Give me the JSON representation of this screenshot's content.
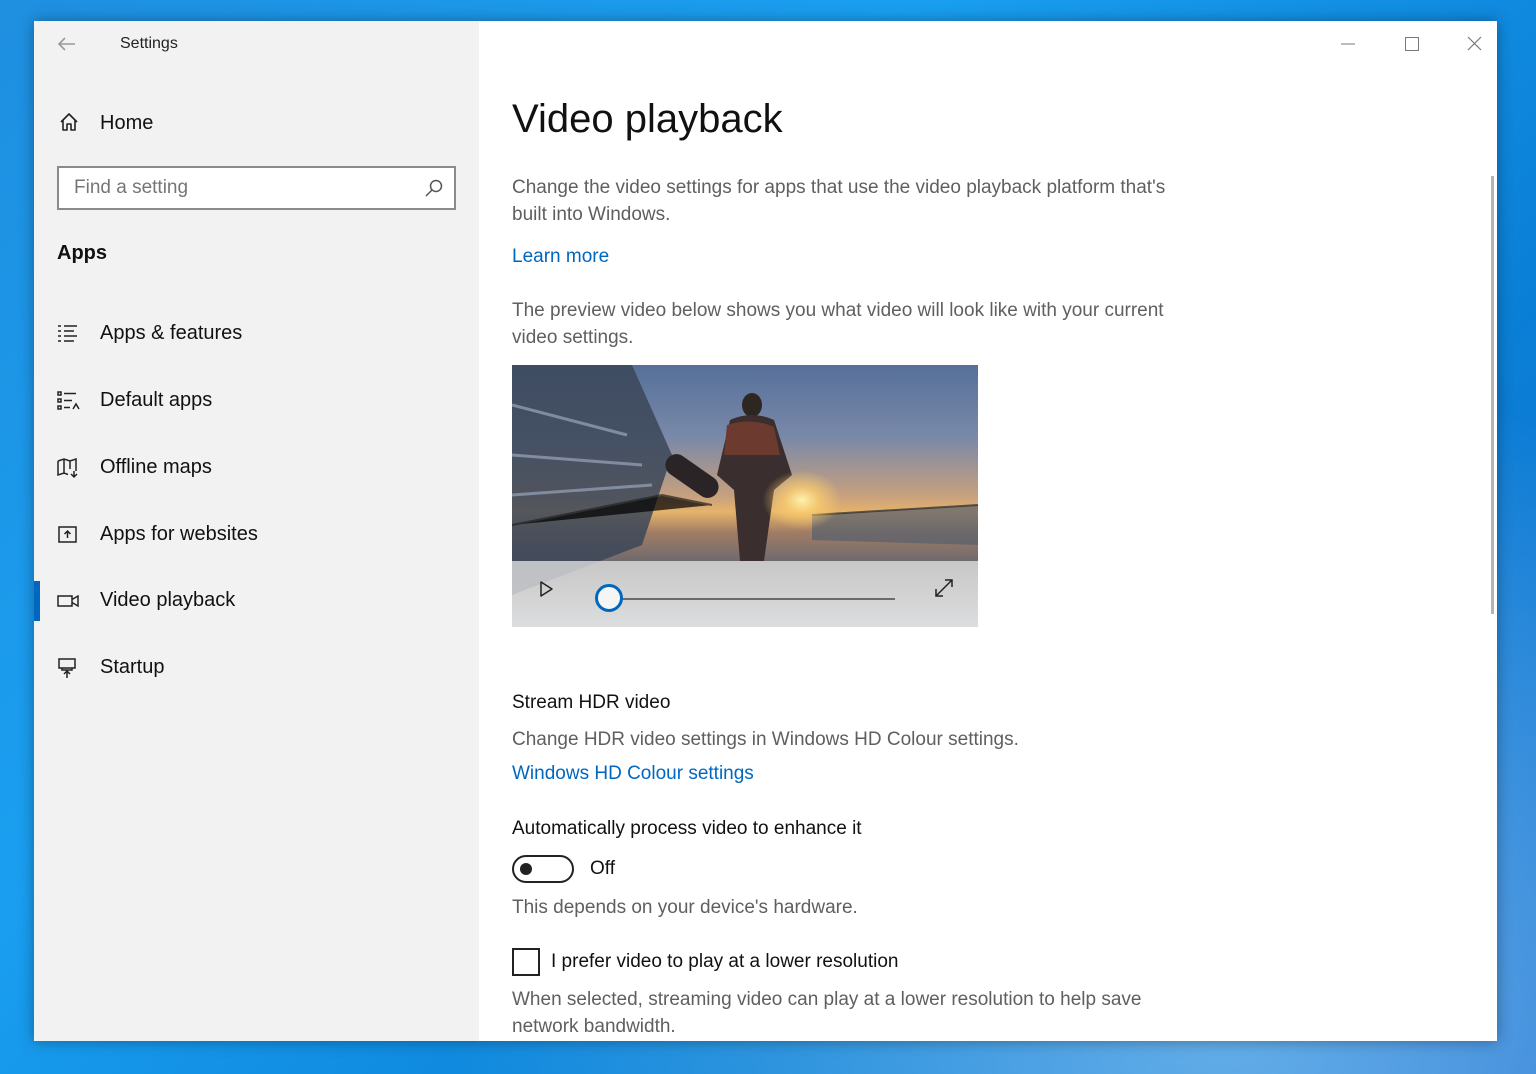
{
  "window": {
    "title": "Settings"
  },
  "sidebar": {
    "home_label": "Home",
    "search": {
      "placeholder": "Find a setting",
      "value": ""
    },
    "section_title": "Apps",
    "items": [
      {
        "label": "Apps & features",
        "icon": "list-icon",
        "selected": false
      },
      {
        "label": "Default apps",
        "icon": "default-apps-icon",
        "selected": false
      },
      {
        "label": "Offline maps",
        "icon": "map-icon",
        "selected": false
      },
      {
        "label": "Apps for websites",
        "icon": "open-in-app-icon",
        "selected": false
      },
      {
        "label": "Video playback",
        "icon": "video-icon",
        "selected": true
      },
      {
        "label": "Startup",
        "icon": "startup-icon",
        "selected": false
      }
    ]
  },
  "main": {
    "title": "Video playback",
    "intro": "Change the video settings for apps that use the video playback platform that's built into Windows.",
    "learn_more": "Learn more",
    "preview_desc": "The preview video below shows you what video will look like with your current video settings.",
    "preview": {
      "seek_progress": 0.0
    },
    "hdr": {
      "heading": "Stream HDR video",
      "desc": "Change HDR video settings in Windows HD Colour settings.",
      "link": "Windows HD Colour settings"
    },
    "enhance": {
      "heading": "Automatically process video to enhance it",
      "state_label": "Off",
      "on": false,
      "note": "This depends on your device's hardware."
    },
    "lower_res": {
      "label": "I prefer video to play at a lower resolution",
      "checked": false,
      "desc": "When selected, streaming video can play at a lower resolution to help save network bandwidth."
    }
  },
  "colors": {
    "accent": "#0067c0",
    "sidebar_bg": "#f2f2f2",
    "secondary_text": "#5f5f5f"
  }
}
